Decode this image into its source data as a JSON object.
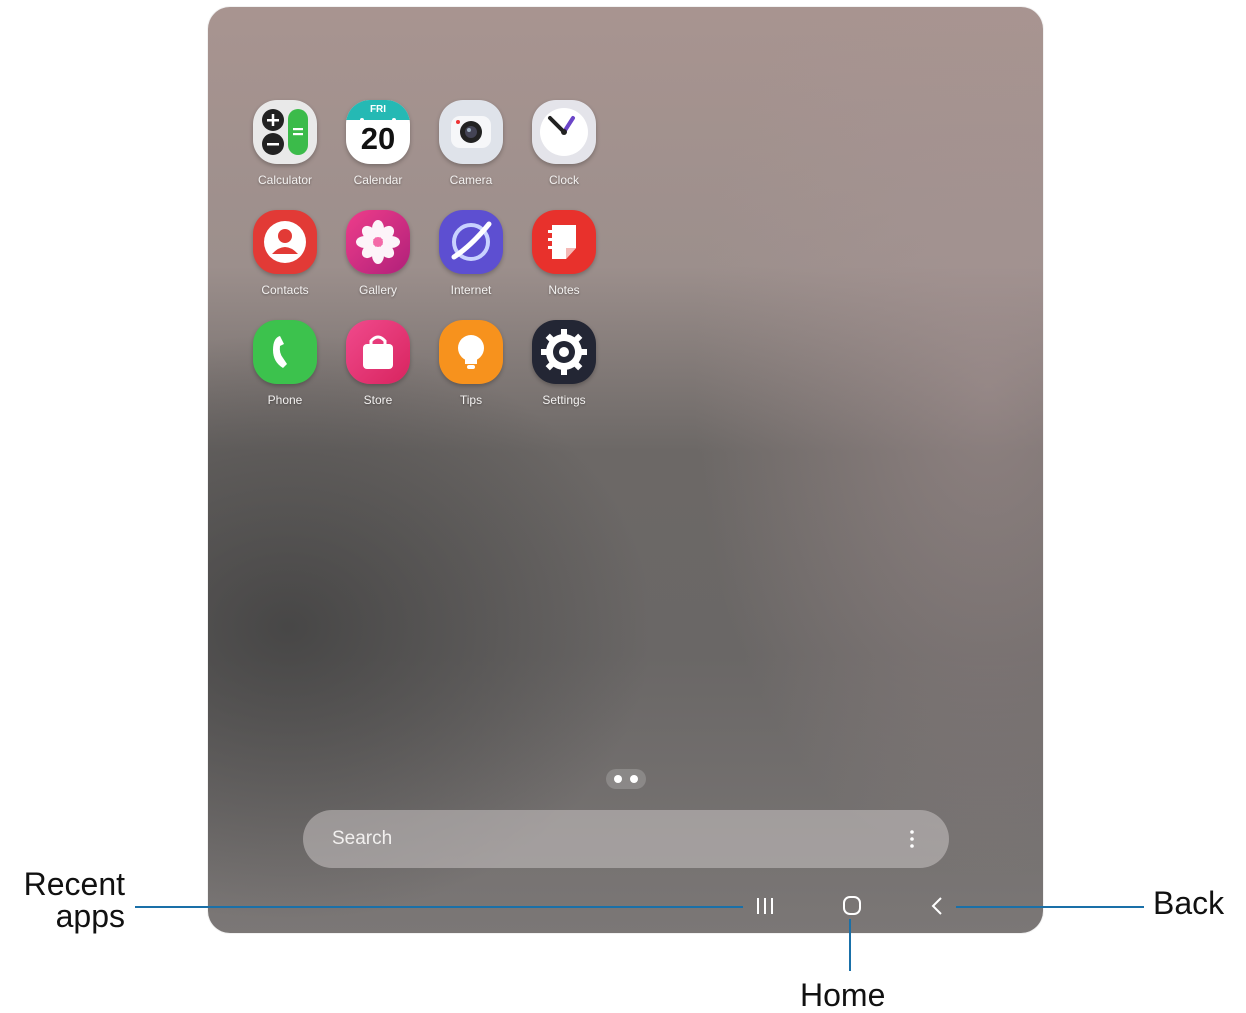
{
  "apps": [
    {
      "label": "Calculator",
      "icon": "calculator-icon"
    },
    {
      "label": "Calendar",
      "icon": "calendar-icon",
      "calendar_day": "FRI",
      "calendar_date": "20"
    },
    {
      "label": "Camera",
      "icon": "camera-icon"
    },
    {
      "label": "Clock",
      "icon": "clock-icon"
    },
    {
      "label": "Contacts",
      "icon": "contacts-icon"
    },
    {
      "label": "Gallery",
      "icon": "gallery-icon"
    },
    {
      "label": "Internet",
      "icon": "internet-icon"
    },
    {
      "label": "Notes",
      "icon": "notes-icon"
    },
    {
      "label": "Phone",
      "icon": "phone-icon"
    },
    {
      "label": "Store",
      "icon": "store-icon"
    },
    {
      "label": "Tips",
      "icon": "tips-icon"
    },
    {
      "label": "Settings",
      "icon": "settings-icon"
    }
  ],
  "search": {
    "placeholder": "Search",
    "menu_icon": "more-vertical-icon"
  },
  "page_indicator": {
    "pages": 2
  },
  "nav_bar": {
    "recent_icon": "recent-apps-icon",
    "home_icon": "home-icon",
    "back_icon": "back-icon"
  },
  "callouts": {
    "recent_line1": "Recent",
    "recent_line2": "apps",
    "home": "Home",
    "back": "Back"
  },
  "colors": {
    "callout_line": "#1a70a8",
    "calendar_teal": "#25b9b4",
    "contacts_red": "#e23a36",
    "phone_green": "#3cc24d",
    "tips_orange": "#f7921d",
    "internet_purple": "#5d4fd1"
  }
}
